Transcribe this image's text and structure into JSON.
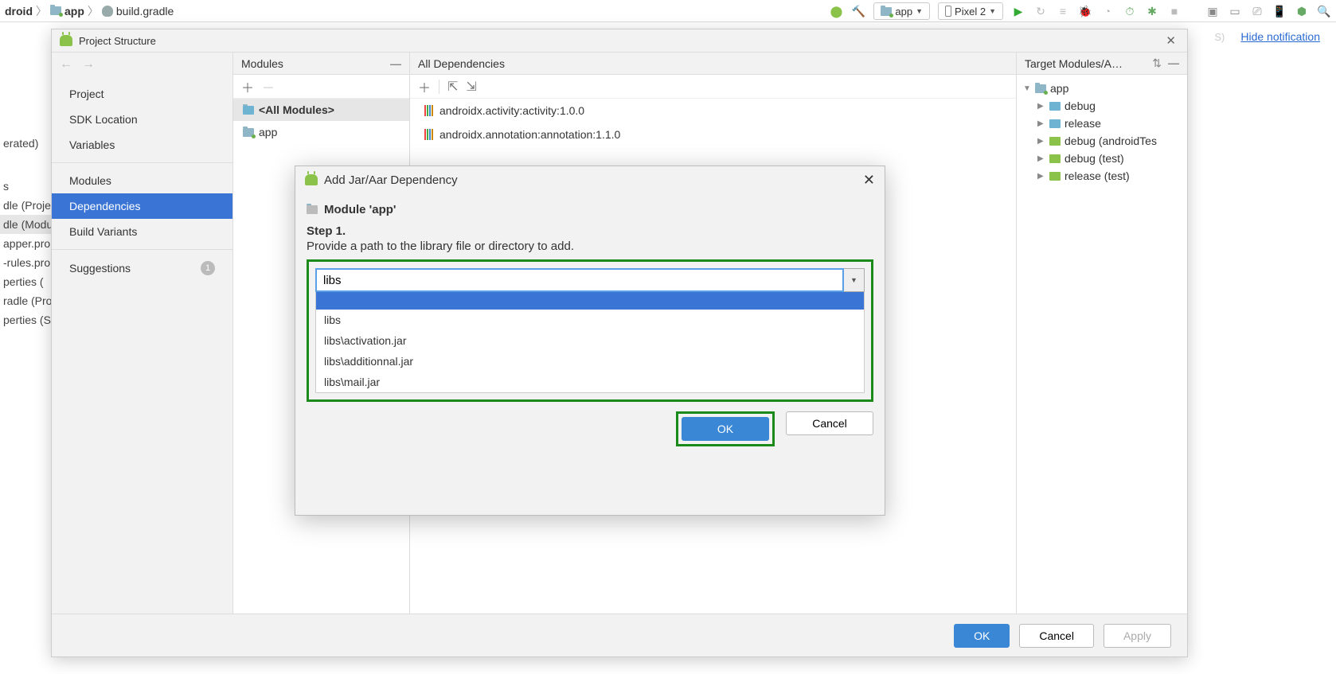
{
  "breadcrumb": {
    "root": "droid",
    "folder": "app",
    "file": "build.gradle"
  },
  "toolbar": {
    "config": "app",
    "device": "Pixel 2"
  },
  "notification": {
    "hide": "Hide notification"
  },
  "left_frags": [
    "s",
    "dle (Proje",
    "dle (Modu",
    "apper.pro",
    "-rules.pro",
    "perties (",
    "radle (Pro",
    "perties (S"
  ],
  "left_top": [
    "",
    "erated)"
  ],
  "ps": {
    "title": "Project Structure",
    "nav": [
      "Project",
      "SDK Location",
      "Variables",
      "Modules",
      "Dependencies",
      "Build Variants",
      "Suggestions"
    ],
    "badge": "1",
    "modules_header": "Modules",
    "all_modules": "<All Modules>",
    "module_app": "app",
    "deps_header": "All Dependencies",
    "deps": [
      "androidx.activity:activity:1.0.0",
      "androidx.annotation:annotation:1.1.0"
    ],
    "target_header": "Target Modules/A…",
    "tree": {
      "root": "app",
      "children": [
        "debug",
        "release",
        "debug (androidTes",
        "debug (test)",
        "release (test)"
      ]
    },
    "footer": {
      "ok": "OK",
      "cancel": "Cancel",
      "apply": "Apply"
    }
  },
  "dlg": {
    "title": "Add Jar/Aar Dependency",
    "module": "Module 'app'",
    "step": "Step 1.",
    "desc": "Provide a path to the library file or directory to add.",
    "input": "libs",
    "options": [
      "",
      "libs",
      "libs\\activation.jar",
      "libs\\additionnal.jar",
      "libs\\mail.jar"
    ],
    "ok": "OK",
    "cancel": "Cancel"
  }
}
